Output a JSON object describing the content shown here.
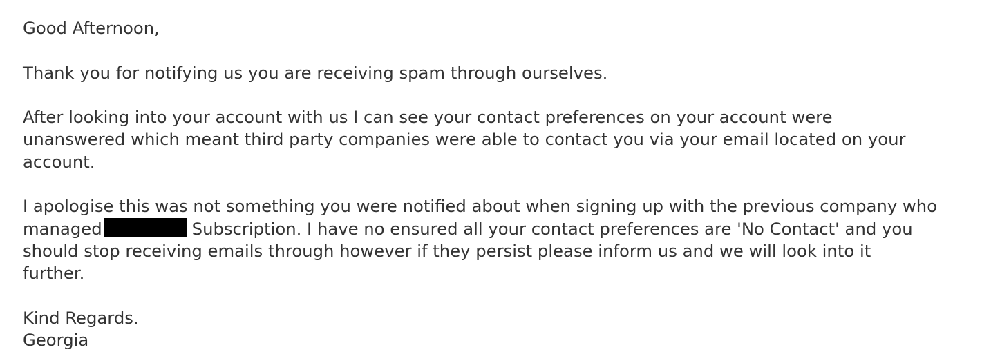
{
  "email": {
    "greeting": "Good Afternoon,",
    "paragraph_1": "Thank you for notifying us you are receiving spam through ourselves.",
    "paragraph_2_line_1": "After looking into your account with us I can see your contact preferences on your account were",
    "paragraph_2_line_2": "unanswered which meant third party companies were able to contact you via your email located on your",
    "paragraph_2_line_3": "account.",
    "paragraph_3_line_1": "I apologise this was not something you were notified about when signing up with the previous company who",
    "paragraph_3_line_2_before": "managed",
    "paragraph_3_line_2_after": "Subscription. I have no ensured all your contact preferences are 'No Contact' and you",
    "paragraph_3_line_3": "should stop receiving emails through however if they persist please inform us and we will look into it",
    "paragraph_3_line_4": "further.",
    "signoff": "Kind Regards.",
    "signature": "Georgia",
    "redaction_color": "#000000",
    "text_color": "#333333"
  }
}
